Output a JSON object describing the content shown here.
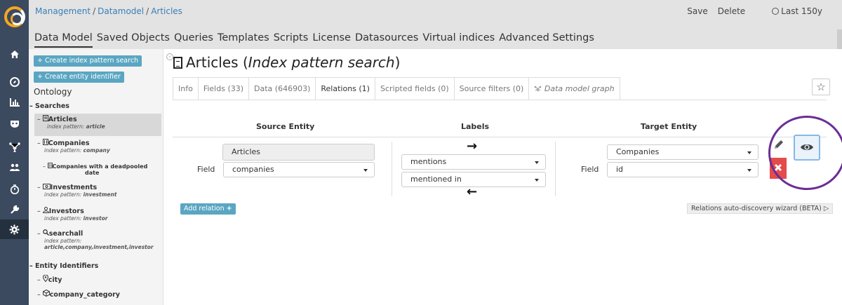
{
  "breadcrumb": [
    "Management",
    "Datamodel",
    "Articles"
  ],
  "breadcrumb_sep": "/",
  "top_actions": {
    "save": "Save",
    "delete": "Delete",
    "time": "Last 150y"
  },
  "topnav": [
    "Data Model",
    "Saved Objects",
    "Queries",
    "Templates",
    "Scripts",
    "License",
    "Datasources",
    "Virtual indices",
    "Advanced Settings"
  ],
  "rail_icons": [
    "home-icon",
    "compass-icon",
    "bar-chart-icon",
    "shield-mask-icon",
    "graph-icon",
    "users-icon",
    "timer-icon",
    "wrench-icon",
    "gear-icon"
  ],
  "left": {
    "create_search": "+ Create index pattern search",
    "create_entity": "+ Create entity identifier",
    "ontology": "Ontology",
    "searches_title": "– Searches",
    "searches": [
      {
        "prefix": "–",
        "name": "Articles",
        "sub_label": "index pattern:",
        "sub_value": "article",
        "icon": "document-icon"
      },
      {
        "prefix": "–",
        "name": "Companies",
        "sub_label": "index pattern:",
        "sub_value": "company",
        "icon": "building-icon"
      },
      {
        "prefix": "–",
        "name": "Companies with a deadpooled",
        "name2": "date",
        "icon": "building-icon"
      },
      {
        "prefix": "–",
        "name": "Investments",
        "sub_label": "index pattern:",
        "sub_value": "investment",
        "icon": "money-icon"
      },
      {
        "prefix": "–",
        "name": "Investors",
        "sub_label": "index pattern:",
        "sub_value": "investor",
        "icon": "person-icon"
      },
      {
        "prefix": "–",
        "name": "searchall",
        "sub_label": "index pattern:",
        "sub_value": "article,company,investment,investor",
        "icon": "search-icon"
      }
    ],
    "entities_title": "– Entity Identifiers",
    "entities": [
      {
        "prefix": "–",
        "name": "city",
        "icon": "map-pin-icon"
      },
      {
        "prefix": "–",
        "name": "company_category",
        "icon": "cube-icon"
      }
    ]
  },
  "main": {
    "title": "Articles",
    "title_type": "Index pattern search",
    "tabs": [
      "Info",
      "Fields (33)",
      "Data (646903)",
      "Relations (1)",
      "Scripted fields (0)",
      "Source filters (0)",
      "Data model graph"
    ],
    "active_tab": "Relations (1)",
    "relations": {
      "header_source": "Source Entity",
      "header_labels": "Labels",
      "header_target": "Target Entity",
      "field_label": "Field",
      "source_entity": "Articles",
      "source_field": "companies",
      "label_forward": "mentions",
      "label_backward": "mentioned in",
      "target_entity": "Companies",
      "target_field": "id",
      "arrow_forward": "→",
      "arrow_backward": "←"
    },
    "add_relation": "Add relation",
    "wizard": "Relations auto-discovery wizard (BETA)"
  }
}
